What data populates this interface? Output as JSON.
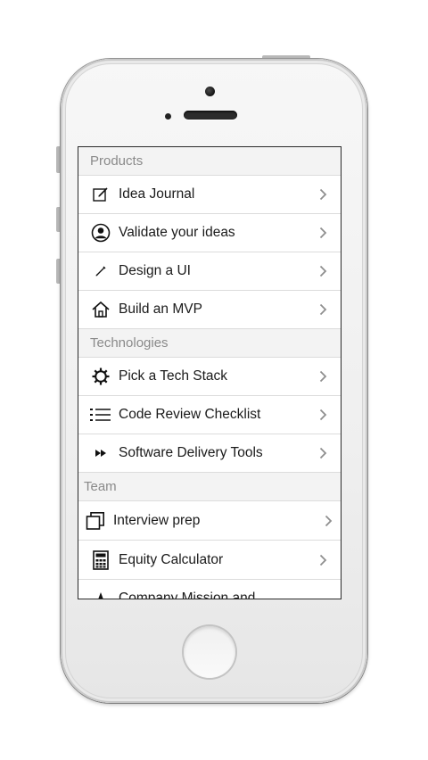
{
  "sections": [
    {
      "title": "Products",
      "items": [
        {
          "label": "Idea Journal",
          "icon": "edit-icon"
        },
        {
          "label": "Validate your ideas",
          "icon": "person-icon"
        },
        {
          "label": "Design a UI",
          "icon": "pencil-icon"
        },
        {
          "label": "Build an MVP",
          "icon": "home-icon"
        }
      ]
    },
    {
      "title": "Technologies",
      "items": [
        {
          "label": "Pick a Tech Stack",
          "icon": "gear-icon"
        },
        {
          "label": "Code Review Checklist",
          "icon": "list-icon"
        },
        {
          "label": "Software Delivery Tools",
          "icon": "fast-forward-icon"
        }
      ]
    },
    {
      "title": "Team",
      "items": [
        {
          "label": "Interview prep",
          "icon": "copy-icon"
        },
        {
          "label": "Equity Calculator",
          "icon": "calculator-icon"
        },
        {
          "label": "Company Mission and",
          "icon": "star-icon"
        }
      ]
    }
  ],
  "colors": {
    "header_bg": "#f3f3f3",
    "header_text": "#8a8a8a",
    "row_text": "#1a1a1a",
    "chevron": "#8e8e8e",
    "separator": "#dcdcdc"
  }
}
